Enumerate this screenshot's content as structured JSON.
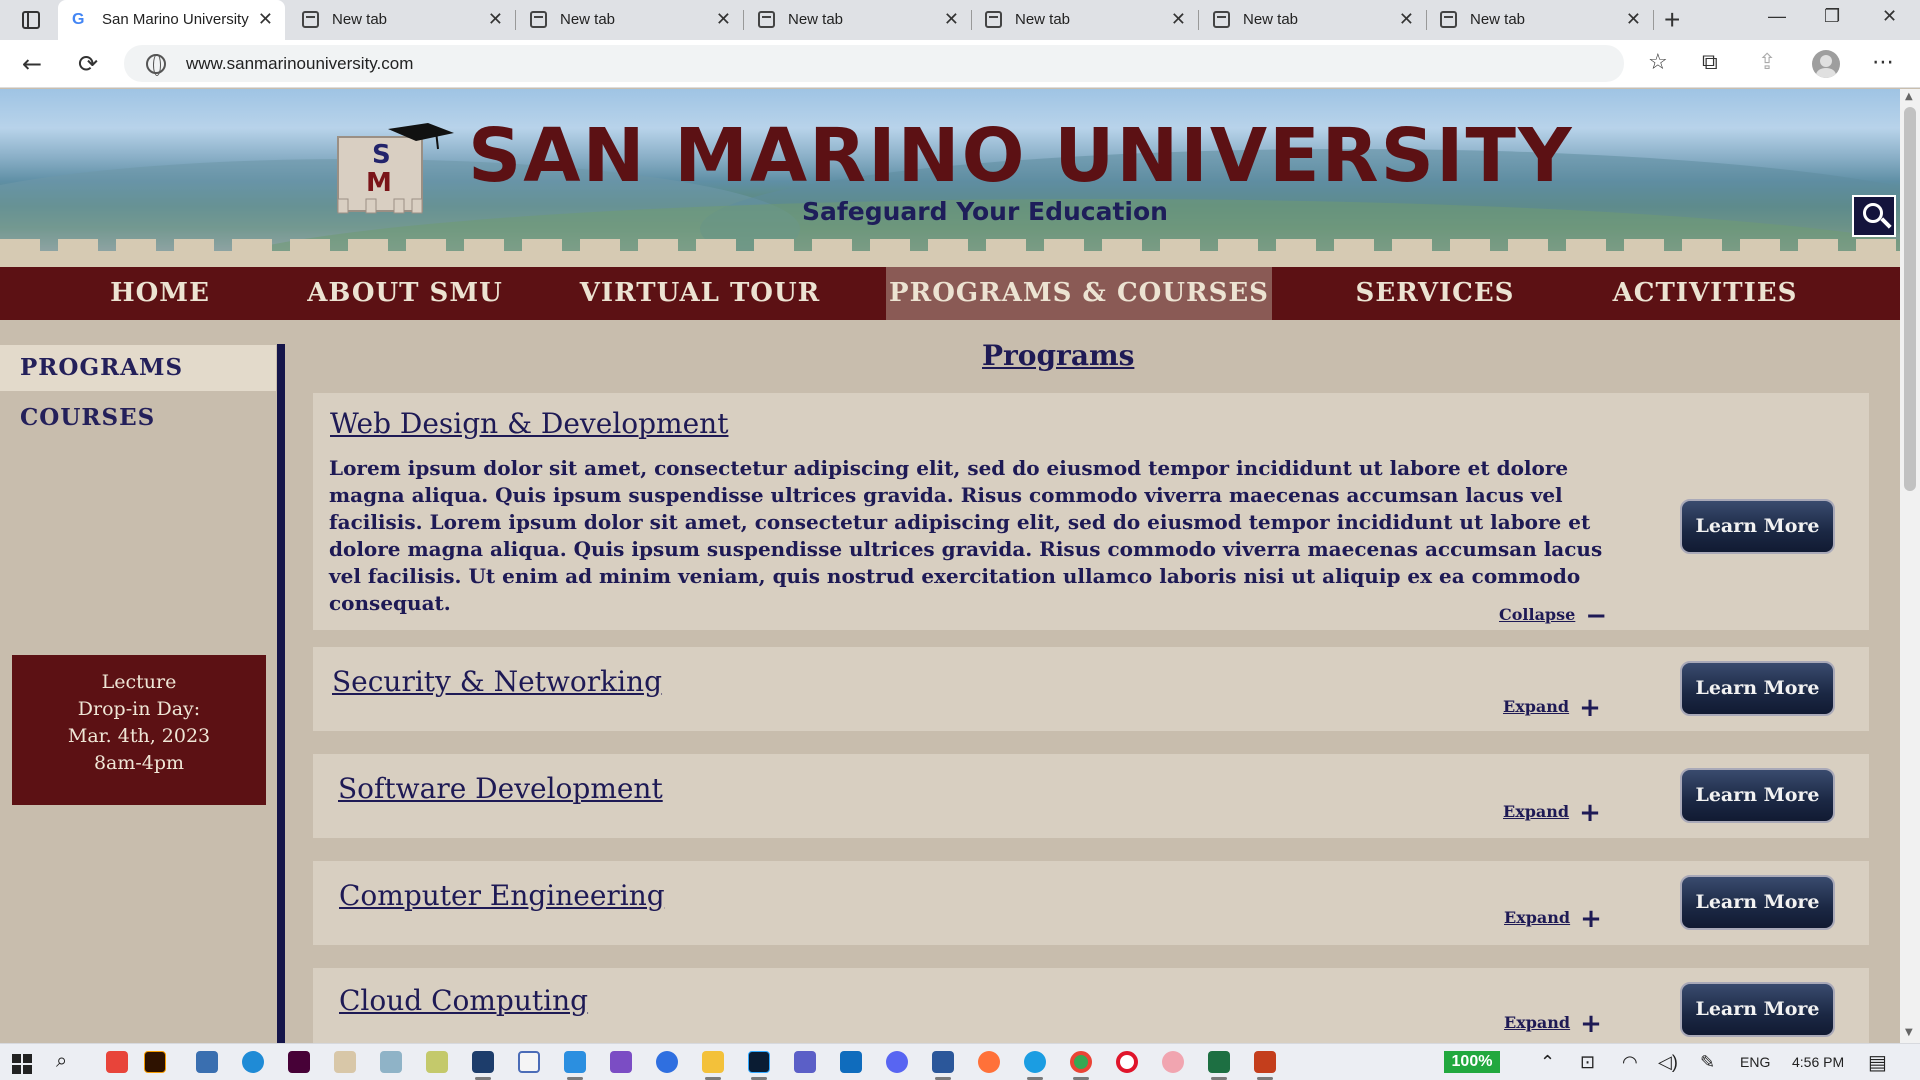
{
  "browser": {
    "tabs": [
      {
        "label": "San Marino University",
        "active": true,
        "icon": "google-icon"
      },
      {
        "label": "New tab",
        "active": false,
        "icon": "newtab-page-icon"
      },
      {
        "label": "New tab",
        "active": false,
        "icon": "newtab-page-icon"
      },
      {
        "label": "New tab",
        "active": false,
        "icon": "newtab-page-icon"
      },
      {
        "label": "New tab",
        "active": false,
        "icon": "newtab-page-icon"
      },
      {
        "label": "New tab",
        "active": false,
        "icon": "newtab-page-icon"
      },
      {
        "label": "New tab",
        "active": false,
        "icon": "newtab-page-icon"
      }
    ],
    "url": "www.sanmarinouniversity.com",
    "icons": {
      "back": "←",
      "reload": "⟳",
      "favorites": "☆",
      "collections": "⧉",
      "share": "⇪",
      "more": "⋯",
      "new_tab": "+",
      "minimize": "—",
      "maximize": "❐",
      "close": "✕",
      "tab_close": "✕"
    }
  },
  "site": {
    "title": "SAN MARINO UNIVERSITY",
    "tagline": "Safeguard Your Education",
    "logo_letters": [
      "S",
      "M"
    ],
    "nav": [
      {
        "label": "HOME",
        "active": false
      },
      {
        "label": "ABOUT SMU",
        "active": false
      },
      {
        "label": "VIRTUAL TOUR",
        "active": false
      },
      {
        "label": "PROGRAMS & COURSES",
        "active": true
      },
      {
        "label": "SERVICES",
        "active": false
      },
      {
        "label": "ACTIVITIES",
        "active": false
      }
    ],
    "sidebar": [
      {
        "label": "PROGRAMS",
        "active": true
      },
      {
        "label": "COURSES",
        "active": false
      }
    ],
    "event": {
      "line1": "Lecture",
      "line2": "Drop-in Day:",
      "line3": "Mar. 4th, 2023",
      "line4": "8am-4pm"
    },
    "main_title": "Programs",
    "learn_more_label": "Learn More",
    "programs": [
      {
        "title": "Web Design & Development",
        "expanded": true,
        "body": "Lorem ipsum dolor sit amet, consectetur adipiscing elit, sed do eiusmod tempor incididunt ut labore et dolore magna aliqua. Quis ipsum suspendisse ultrices gravida. Risus commodo viverra maecenas accumsan lacus vel facilisis.  Lorem ipsum dolor sit amet, consectetur adipiscing elit, sed do eiusmod tempor incididunt ut labore et dolore magna aliqua. Quis ipsum suspendisse ultrices gravida. Risus commodo viverra maecenas accumsan lacus vel facilisis. Ut enim ad minim veniam, quis nostrud exercitation ullamco laboris nisi ut aliquip ex ea commodo consequat.",
        "toggle_label": "Collapse",
        "toggle_symbol": "−"
      },
      {
        "title": "Security & Networking",
        "expanded": false,
        "toggle_label": "Expand",
        "toggle_symbol": "+"
      },
      {
        "title": "Software Development",
        "expanded": false,
        "toggle_label": "Expand",
        "toggle_symbol": "+"
      },
      {
        "title": "Computer Engineering",
        "expanded": false,
        "toggle_label": "Expand",
        "toggle_symbol": "+"
      },
      {
        "title": "Cloud Computing",
        "expanded": false,
        "toggle_label": "Expand",
        "toggle_symbol": "+"
      }
    ]
  },
  "taskbar": {
    "zoom": "100%",
    "language": "ENG",
    "time": "4:56 PM",
    "colors": {
      "running_indicator": "#7a7a7a",
      "zoom_badge": "#22a83e"
    }
  },
  "colors": {
    "brand_maroon": "#5c1114",
    "navy": "#1e1a55",
    "nav_active": "#8a5a55",
    "parchment": "#c8bdad"
  }
}
